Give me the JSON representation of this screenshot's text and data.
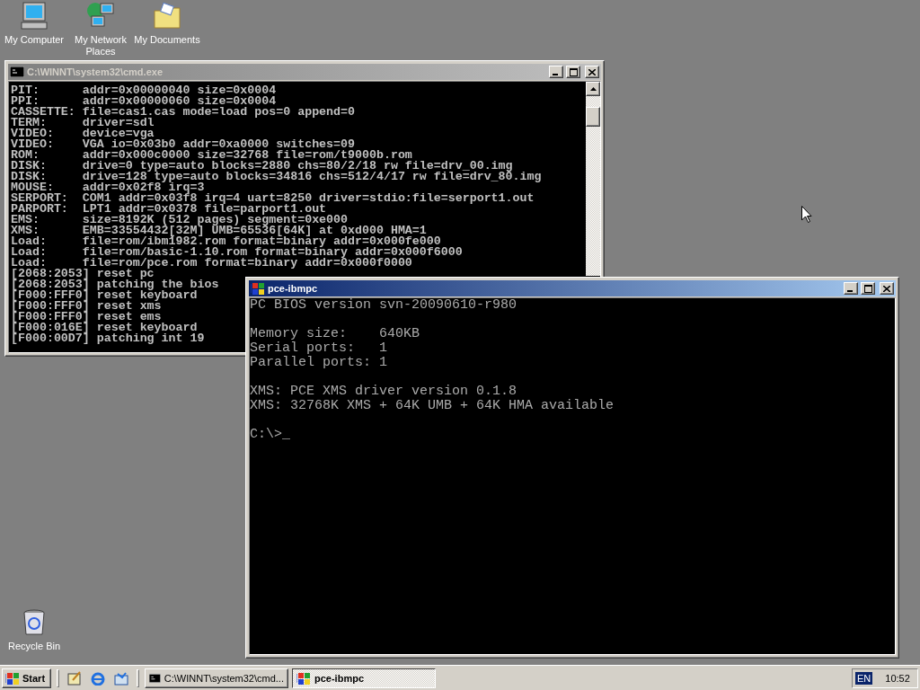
{
  "desktop_icons": [
    {
      "label": "My Computer",
      "kind": "computer"
    },
    {
      "label": "My Network Places",
      "kind": "network"
    },
    {
      "label": "My Documents",
      "kind": "documents"
    },
    {
      "label": "Recycle Bin",
      "kind": "recycle"
    }
  ],
  "console_window": {
    "title": "C:\\WINNT\\system32\\cmd.exe",
    "active": false,
    "lines": [
      "PIT:      addr=0x00000040 size=0x0004",
      "PPI:      addr=0x00000060 size=0x0004",
      "CASSETTE: file=cas1.cas mode=load pos=0 append=0",
      "TERM:     driver=sdl",
      "VIDEO:    device=vga",
      "VIDEO:    VGA io=0x03b0 addr=0xa0000 switches=09",
      "ROM:      addr=0x000c0000 size=32768 file=rom/t9000b.rom",
      "DISK:     drive=0 type=auto blocks=2880 chs=80/2/18 rw file=drv_00.img",
      "DISK:     drive=128 type=auto blocks=34816 chs=512/4/17 rw file=drv_80.img",
      "MOUSE:    addr=0x02f8 irq=3",
      "SERPORT:  COM1 addr=0x03f8 irq=4 uart=8250 driver=stdio:file=serport1.out",
      "PARPORT:  LPT1 addr=0x0378 file=parport1.out",
      "EMS:      size=8192K (512 pages) segment=0xe000",
      "XMS:      EMB=33554432[32M] UMB=65536[64K] at 0xd000 HMA=1",
      "Load:     file=rom/ibm1982.rom format=binary addr=0x000fe000",
      "Load:     file=rom/basic-1.10.rom format=binary addr=0x000f6000",
      "Load:     file=rom/pce.rom format=binary addr=0x000f0000",
      "[2068:2053] reset pc",
      "[2068:2053] patching the bios",
      "[F000:FFF0] reset keyboard",
      "[F000:FFF0] reset xms",
      "[F000:FFF0] reset ems",
      "[F000:016E] reset keyboard",
      "[F000:00D7] patching int 19"
    ]
  },
  "emulator_window": {
    "title": "pce-ibmpc",
    "active": true,
    "paragraphs": [
      [
        "PC BIOS version svn-20090610-r980"
      ],
      [
        "Memory size:    640KB",
        "Serial ports:   1",
        "Parallel ports: 1"
      ],
      [
        "XMS: PCE XMS driver version 0.1.8",
        "XMS: 32768K XMS + 64K UMB + 64K HMA available"
      ],
      [
        "C:\\>_"
      ]
    ]
  },
  "taskbar": {
    "start_label": "Start",
    "tasks": [
      {
        "label": "C:\\WINNT\\system32\\cmd...",
        "kind": "console",
        "selected": false
      },
      {
        "label": "pce-ibmpc",
        "kind": "emulator",
        "selected": true
      }
    ],
    "tray": {
      "language": "EN",
      "time": "10:52"
    }
  }
}
